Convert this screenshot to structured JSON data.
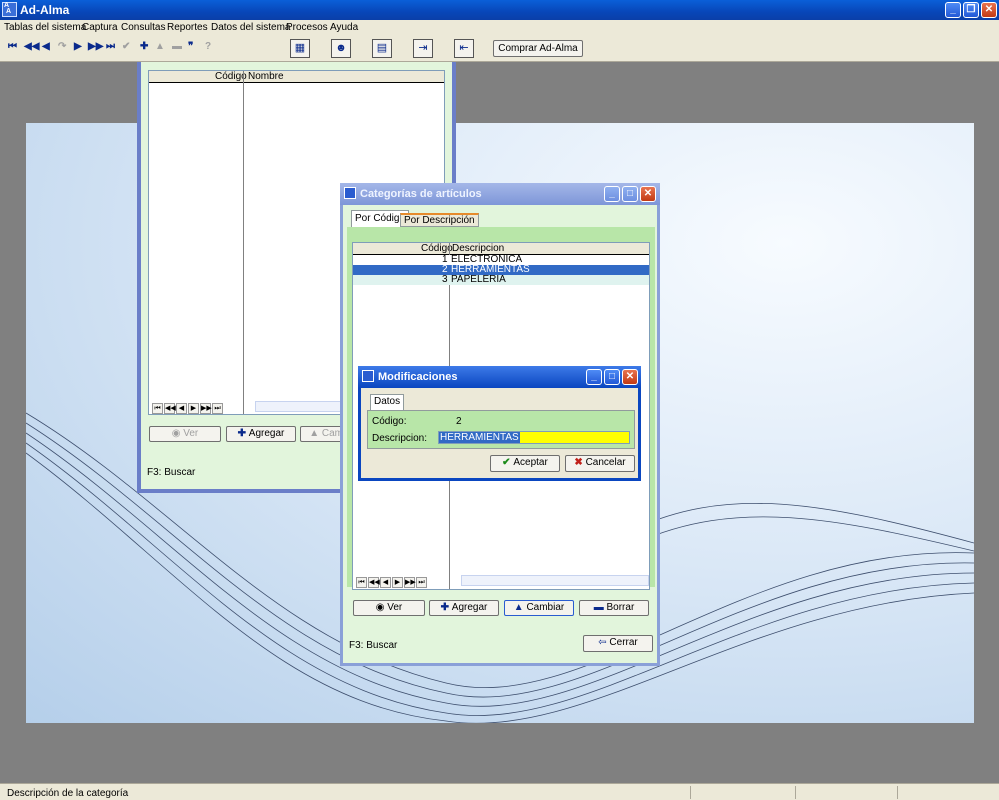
{
  "app": {
    "title": "Ad-Alma",
    "icon_label": "A A"
  },
  "menu": [
    "Tablas del sistema",
    "Captura",
    "Consultas",
    "Reportes",
    "Datos del sistema",
    "Procesos",
    "Ayuda"
  ],
  "toolbar": {
    "buy_label": "Comprar Ad-Alma",
    "nav_icons": [
      "first-icon",
      "prev-page-icon",
      "prev-icon",
      "undo-icon",
      "next-icon",
      "next-page-icon",
      "last-icon",
      "check-icon",
      "add-icon",
      "up-icon",
      "minus-icon",
      "quote-icon",
      "help-icon"
    ]
  },
  "back_window": {
    "columns": [
      "Código",
      "Nombre"
    ],
    "buttons": {
      "view": "Ver",
      "add": "Agregar",
      "change": "Cambi"
    },
    "hint": "F3: Buscar"
  },
  "categories_window": {
    "title": "Categorías de artículos",
    "tabs": [
      "Por Código",
      "Por Descripción"
    ],
    "columns": [
      "Código",
      "Descripcion"
    ],
    "rows": [
      {
        "code": "1",
        "description": "ELECTRONICA"
      },
      {
        "code": "2",
        "description": "HERRAMIENTAS"
      },
      {
        "code": "3",
        "description": "PAPELERIA"
      }
    ],
    "buttons": {
      "view": "Ver",
      "add": "Agregar",
      "change": "Cambiar",
      "delete": "Borrar",
      "close": "Cerrar"
    },
    "hint": "F3: Buscar"
  },
  "modal": {
    "title": "Modificaciones",
    "tab": "Datos",
    "code_label": "Código:",
    "code_value": "2",
    "desc_label": "Descripcion:",
    "desc_value": "HERRAMIENTAS",
    "accept": "Aceptar",
    "cancel": "Cancelar"
  },
  "status": {
    "text": "Descripción de la categoría"
  },
  "colors": {
    "titlebar": "#0846b8",
    "grid_green": "#e2f5dc",
    "selection": "#316ac5",
    "input_highlight": "#ffff00"
  }
}
